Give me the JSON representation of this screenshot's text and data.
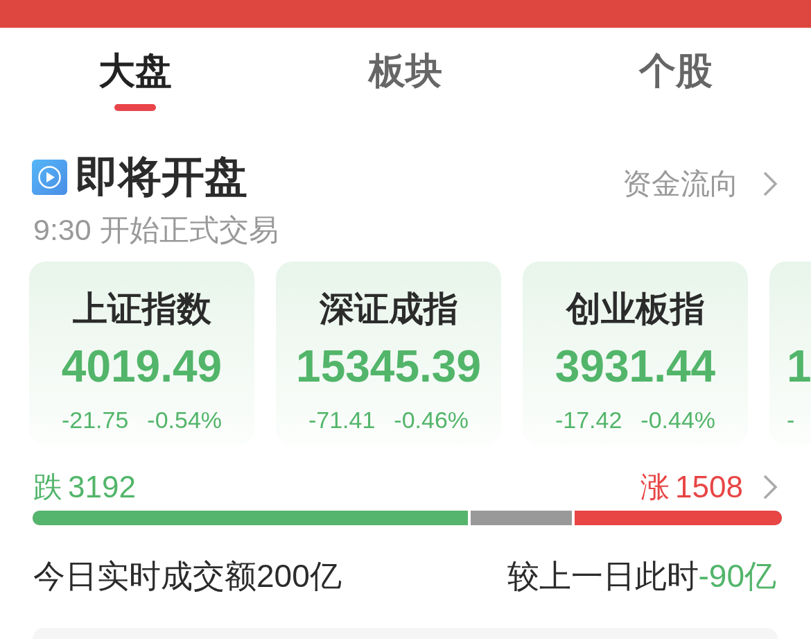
{
  "tabs": [
    {
      "label": "大盘",
      "selected": true
    },
    {
      "label": "板块",
      "selected": false
    },
    {
      "label": "个股",
      "selected": false
    }
  ],
  "market_status": {
    "title": "即将开盘",
    "subtitle": "9:30 开始正式交易",
    "link": "资金流向"
  },
  "index_cards": [
    {
      "kind": "full",
      "name": "上证指数",
      "value": "4019.49",
      "change": "-21.75",
      "change_percent": "-0.54%",
      "color": "#52b56a"
    },
    {
      "kind": "full",
      "name": "深证成指",
      "value": "15345.39",
      "change": "-71.41",
      "change_percent": "-0.46%",
      "color": "#52b56a"
    },
    {
      "kind": "full",
      "name": "创业板指",
      "value": "3931.44",
      "change": "-17.42",
      "change_percent": "-0.44%",
      "color": "#52b56a"
    },
    {
      "kind": "clipped",
      "value": "1",
      "change": "-",
      "color": "#52b56a"
    }
  ],
  "breadth": {
    "decline": {
      "label": "跌",
      "count": "3192",
      "level": 0.581
    },
    "advance": {
      "label": "涨",
      "count": "1508",
      "level": 0.277
    }
  },
  "turnover": {
    "amount": "今日实时成交额200亿",
    "compare": {
      "label": "较上一日此时",
      "value": "-90亿",
      "color": "#52b56a"
    }
  }
}
